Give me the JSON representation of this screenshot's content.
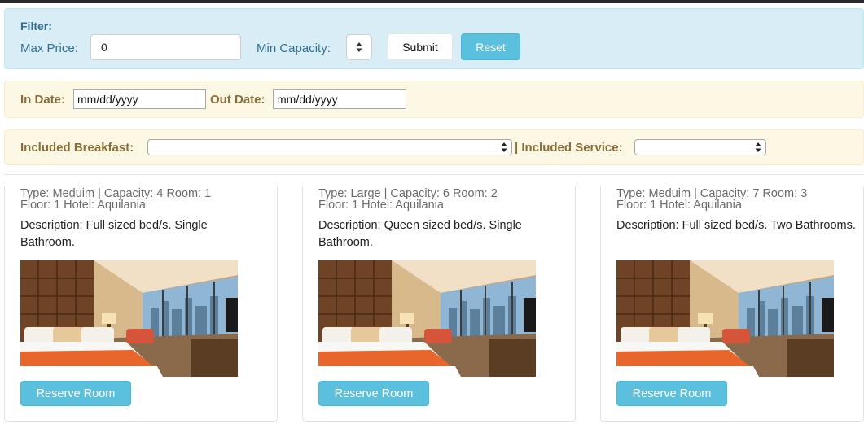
{
  "filter": {
    "title": "Filter:",
    "max_price_label": "Max Price:",
    "max_price_value": "0",
    "min_capacity_label": "Min Capacity:",
    "submit_label": "Submit",
    "reset_label": "Reset"
  },
  "dates": {
    "in_label": "In Date:",
    "in_value": "mm/dd/yyyy",
    "out_label": "Out Date:",
    "out_value": "mm/dd/yyyy"
  },
  "options": {
    "breakfast_label": "Included Breakfast:",
    "service_label": "| Included Service:",
    "breakfast_value": "",
    "service_value": ""
  },
  "rooms": [
    {
      "type_line1": "Type: Meduim | Capacity: 4 Room: 1",
      "type_line2": "Floor: 1 Hotel: Aquilania",
      "description": "Description: Full sized bed/s. Single Bathroom.",
      "reserve_label": "Reserve Room"
    },
    {
      "type_line1": "Type: Large | Capacity: 6 Room: 2",
      "type_line2": "Floor: 1 Hotel: Aquilania",
      "description": "Description: Queen sized bed/s. Single Bathroom.",
      "reserve_label": "Reserve Room"
    },
    {
      "type_line1": "Type: Meduim | Capacity: 7 Room: 3",
      "type_line2": "Floor: 1 Hotel: Aquilania",
      "description": "Description: Full sized bed/s. Two Bathrooms.",
      "reserve_label": "Reserve Room"
    }
  ],
  "colors": {
    "info_button": "#5bc0de",
    "filter_panel_bg": "#d9edf7",
    "warning_panel_bg": "#fcf8e3",
    "filter_text": "#31708f",
    "warning_text": "#8a6d3b"
  },
  "icons": {
    "spinner": "up-down-stepper-icon",
    "select_arrows": "select-arrows-icon",
    "room_photo": "hotel-room-photo"
  }
}
